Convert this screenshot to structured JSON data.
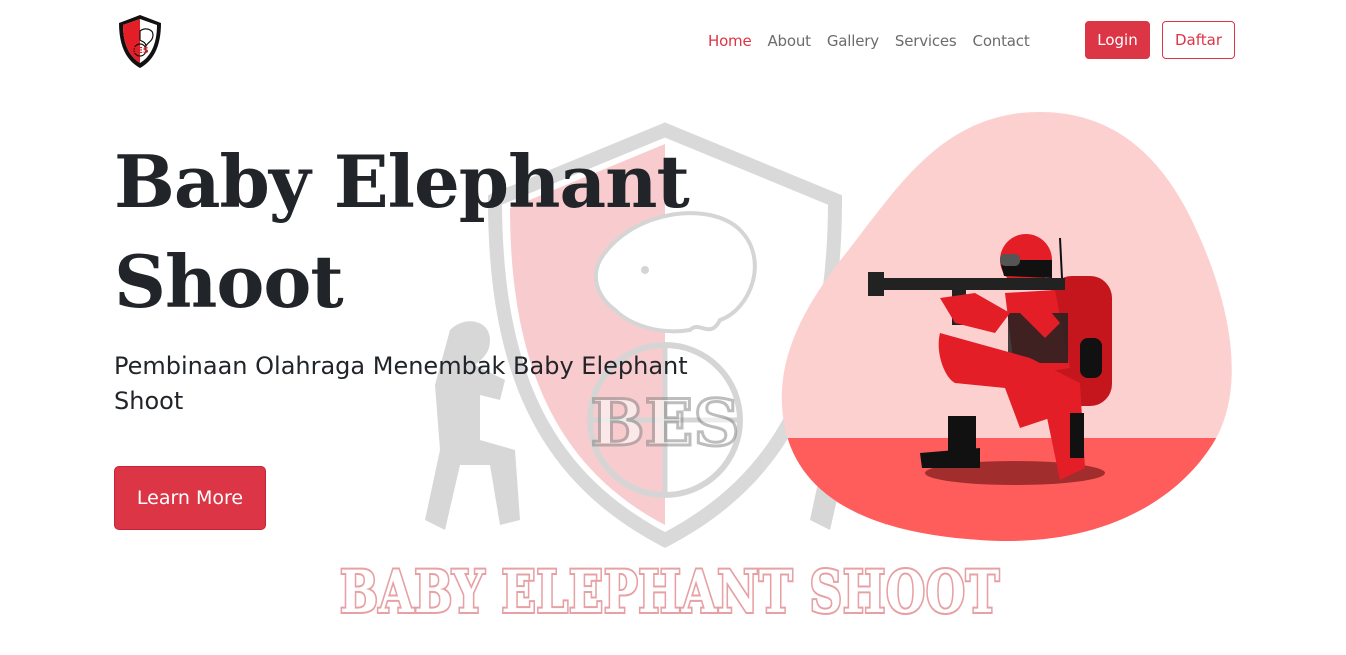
{
  "brand": {
    "logo_icon": "bes-shield-logo-icon",
    "logo_text": "BES"
  },
  "nav": {
    "items": [
      {
        "label": "Home",
        "active": true
      },
      {
        "label": "About",
        "active": false
      },
      {
        "label": "Gallery",
        "active": false
      },
      {
        "label": "Services",
        "active": false
      },
      {
        "label": "Contact",
        "active": false
      }
    ],
    "login_label": "Login",
    "register_label": "Daftar"
  },
  "hero": {
    "title": "Baby Elephant Shoot",
    "subtitle": "Pembinaan Olahraga Menembak Baby Elephant Shoot",
    "cta_label": "Learn More",
    "illustration_icon": "kneeling-shooter-illustration"
  },
  "watermark": {
    "shield_text": "BES",
    "banner_text": "BABY ELEPHANT SHOOT"
  },
  "colors": {
    "accent": "#dc3545",
    "blob": "#fdd0d0",
    "blob_floor": "#ff5c5c",
    "text_dark": "#212529",
    "nav_text": "#6c6c6c"
  }
}
